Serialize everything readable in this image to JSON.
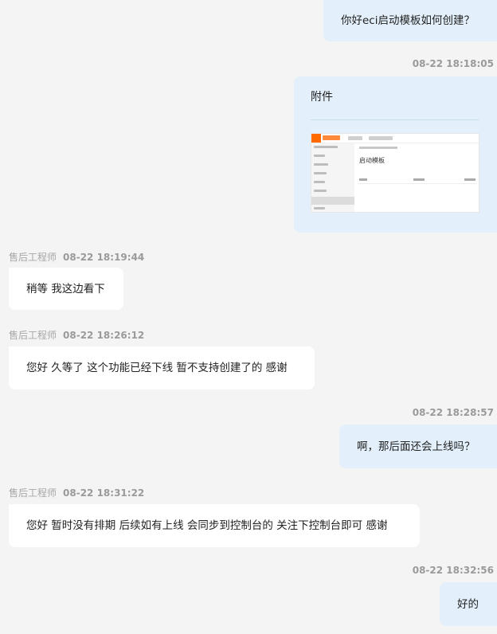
{
  "messages": {
    "m1": {
      "text": "你好eci启动模板如何创建？"
    },
    "m2": {
      "time": "08-22 18:18:05",
      "attachment_label": "附件",
      "thumbnail_title": "启动模板"
    },
    "m3": {
      "sender": "售后工程师",
      "time": "08-22 18:19:44",
      "text": "稍等  我这边看下"
    },
    "m4": {
      "sender": "售后工程师",
      "time": "08-22 18:26:12",
      "text": "您好 久等了  这个功能已经下线   暂不支持创建了的 感谢"
    },
    "m5": {
      "time": "08-22 18:28:57",
      "text": "啊，那后面还会上线吗？"
    },
    "m6": {
      "sender": "售后工程师",
      "time": "08-22 18:31:22",
      "text": "您好  暂时没有排期  后续如有上线  会同步到控制台的  关注下控制台即可 感谢"
    },
    "m7": {
      "time": "08-22 18:32:56",
      "text": "好的"
    }
  },
  "colors": {
    "background": "#f4f4f4",
    "user_bubble": "#e3f0fb",
    "agent_bubble": "#ffffff",
    "meta_text": "#9a9a9a",
    "thumbnail_accent": "#ff6a00"
  }
}
